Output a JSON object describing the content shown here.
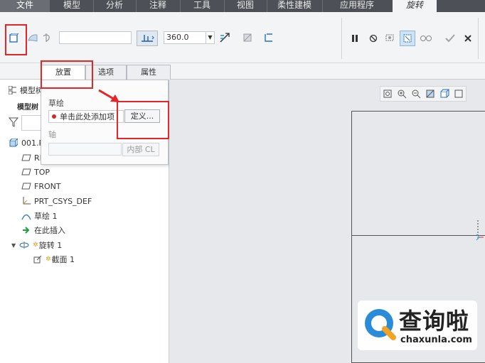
{
  "menu": {
    "file": "文件",
    "tabs": [
      "模型",
      "分析",
      "注释",
      "工具",
      "视图",
      "柔性建模",
      "应用程序"
    ],
    "active": "旋转"
  },
  "ribbon": {
    "angle_value": "360.0"
  },
  "dashboard_tabs": [
    "放置",
    "选项",
    "属性"
  ],
  "tree": {
    "header": "模型树",
    "header_sub": "模型树",
    "items": [
      {
        "label": "001.PRT",
        "icon": "part-icon"
      },
      {
        "label": "RIGHT",
        "icon": "datum-plane-icon"
      },
      {
        "label": "TOP",
        "icon": "datum-plane-icon"
      },
      {
        "label": "FRONT",
        "icon": "datum-plane-icon"
      },
      {
        "label": "PRT_CSYS_DEF",
        "icon": "csys-icon"
      },
      {
        "label": "草绘 1",
        "icon": "sketch-icon"
      },
      {
        "label": "在此插入",
        "icon": "insert-arrow-icon"
      },
      {
        "label": "旋转 1",
        "icon": "revolve-icon"
      },
      {
        "label": "截面 1",
        "icon": "section-icon"
      }
    ]
  },
  "panel": {
    "sketch_label": "草绘",
    "collector_text": "单击此处添加项",
    "define_button": "定义...",
    "axis_label": "轴",
    "internal_button": "内部 CL"
  },
  "watermark": {
    "title": "查询啦",
    "sub": "chaxunla.com"
  },
  "colors": {
    "highlight": "#e3262a",
    "menubar": "#4d5157",
    "accent_blue": "#2a8bd8"
  }
}
